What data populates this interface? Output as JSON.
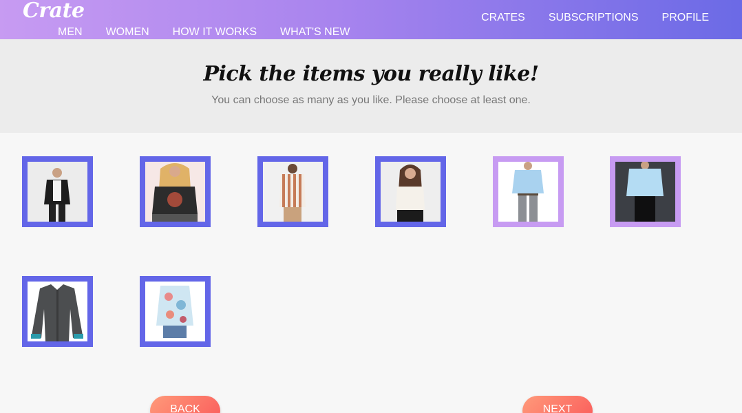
{
  "brand": {
    "logo_text": "Crate"
  },
  "nav": {
    "left": [
      "MEN",
      "WOMEN",
      "HOW IT WORKS",
      "WHAT'S NEW"
    ],
    "right": [
      "CRATES",
      "SUBSCRIPTIONS",
      "PROFILE"
    ]
  },
  "hero": {
    "title": "Pick the items you really like!",
    "subtitle": "You can choose as many as you like. Please choose at least one."
  },
  "items": [
    {
      "icon": "man-black-jacket-photo",
      "selected": false
    },
    {
      "icon": "woman-graphic-tee-photo",
      "selected": false
    },
    {
      "icon": "man-striped-shirt-photo",
      "selected": false
    },
    {
      "icon": "woman-white-top-photo",
      "selected": false
    },
    {
      "icon": "man-blue-shirt-photo",
      "selected": true
    },
    {
      "icon": "woman-blue-shirt-photo",
      "selected": true
    },
    {
      "icon": "gray-dress-shirt-photo",
      "selected": false
    },
    {
      "icon": "woman-floral-shirt-photo",
      "selected": false
    }
  ],
  "buttons": {
    "back": "BACK",
    "next": "NEXT"
  },
  "colors": {
    "tile_border": "#6366e8",
    "tile_selected_border": "#c79bf2",
    "button_gradient_start": "#ff9a7a",
    "button_gradient_end": "#fa5a5a"
  }
}
